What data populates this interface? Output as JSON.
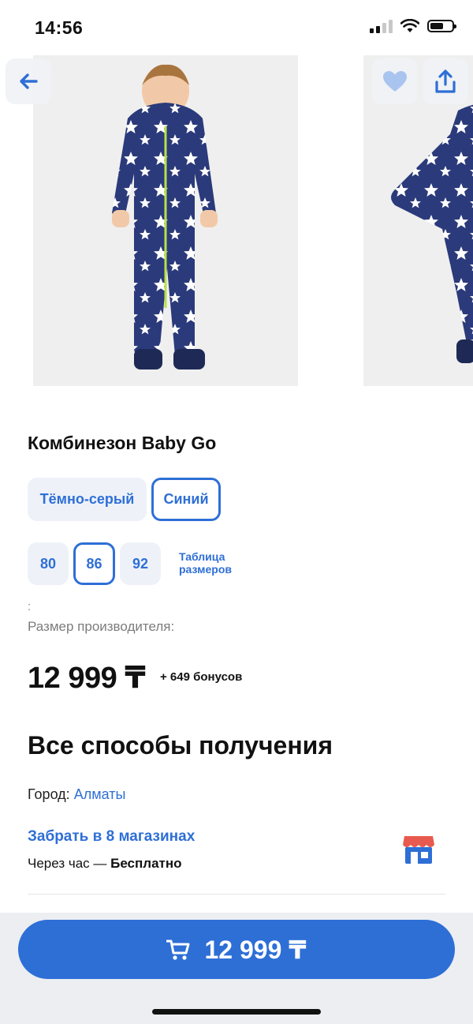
{
  "status": {
    "time": "14:56"
  },
  "product": {
    "title": "Комбинезон Baby Go",
    "colors": [
      {
        "label": "Тёмно-серый",
        "selected": false
      },
      {
        "label": "Синий",
        "selected": true
      }
    ],
    "sizes": [
      {
        "label": "80",
        "selected": false
      },
      {
        "label": "86",
        "selected": true
      },
      {
        "label": "92",
        "selected": false
      }
    ],
    "size_chart_line1": "Таблица",
    "size_chart_line2": "размеров",
    "colon": ":",
    "manufacturer_size_label": "Размер производителя:",
    "price": "12 999 ₸",
    "bonus": "+ 649 бонусов"
  },
  "delivery": {
    "heading": "Все способы получения",
    "city_label": "Город:",
    "city_value": "Алматы",
    "pickup_title": "Забрать в 8 магазинах",
    "pickup_time": "Через час — ",
    "pickup_cost": "Бесплатно"
  },
  "buy_button": {
    "price": "12 999 ₸"
  },
  "icons": {
    "back": "arrow-left-icon",
    "favorite": "heart-icon",
    "share": "share-icon",
    "store": "store-icon",
    "cart": "cart-icon"
  },
  "colors": {
    "accent": "#2e6fd6",
    "chip_bg": "#eef2f8",
    "bottom_bar": "#eceef1"
  }
}
